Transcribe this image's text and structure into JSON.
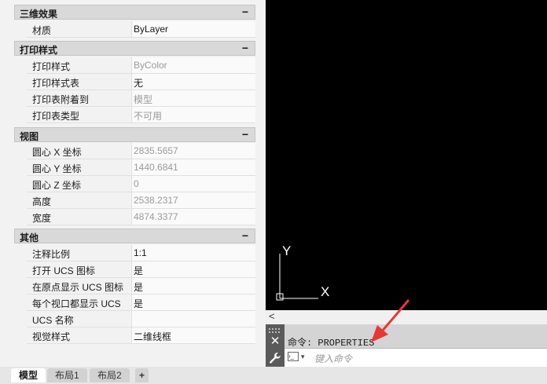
{
  "properties": {
    "sections": [
      {
        "title": "三维效果",
        "toggle": "−",
        "rows": [
          {
            "label": "材质",
            "value": "ByLayer"
          }
        ]
      },
      {
        "title": "打印样式",
        "toggle": "−",
        "rows": [
          {
            "label": "打印样式",
            "value": "ByColor"
          },
          {
            "label": "打印样式表",
            "value": "无"
          },
          {
            "label": "打印表附着到",
            "value": "模型"
          },
          {
            "label": "打印表类型",
            "value": "不可用"
          }
        ]
      },
      {
        "title": "视图",
        "toggle": "−",
        "rows": [
          {
            "label": "圆心 X 坐标",
            "value": "2835.5657"
          },
          {
            "label": "圆心 Y 坐标",
            "value": "1440.6841"
          },
          {
            "label": "圆心 Z 坐标",
            "value": "0"
          },
          {
            "label": "高度",
            "value": "2538.2317"
          },
          {
            "label": "宽度",
            "value": "4874.3377"
          }
        ]
      },
      {
        "title": "其他",
        "toggle": "−",
        "rows": [
          {
            "label": "注释比例",
            "value": "1:1"
          },
          {
            "label": "打开 UCS 图标",
            "value": "是"
          },
          {
            "label": "在原点显示 UCS 图标",
            "value": "是"
          },
          {
            "label": "每个视口都显示 UCS",
            "value": "是"
          },
          {
            "label": "UCS 名称",
            "value": ""
          },
          {
            "label": "视觉样式",
            "value": "二维线框"
          }
        ]
      }
    ]
  },
  "canvas": {
    "ucs_y_label": "Y",
    "ucs_x_label": "X"
  },
  "scroll": {
    "left_arrow": "<"
  },
  "command": {
    "history": "命令: PROPERTIES",
    "placeholder": "键入命令",
    "close_glyph": "✕",
    "wrench_glyph": "🔧"
  },
  "tabs": [
    {
      "label": "模型",
      "active": true
    },
    {
      "label": "布局1",
      "active": false
    },
    {
      "label": "布局2",
      "active": false
    }
  ],
  "add_tab": "+"
}
